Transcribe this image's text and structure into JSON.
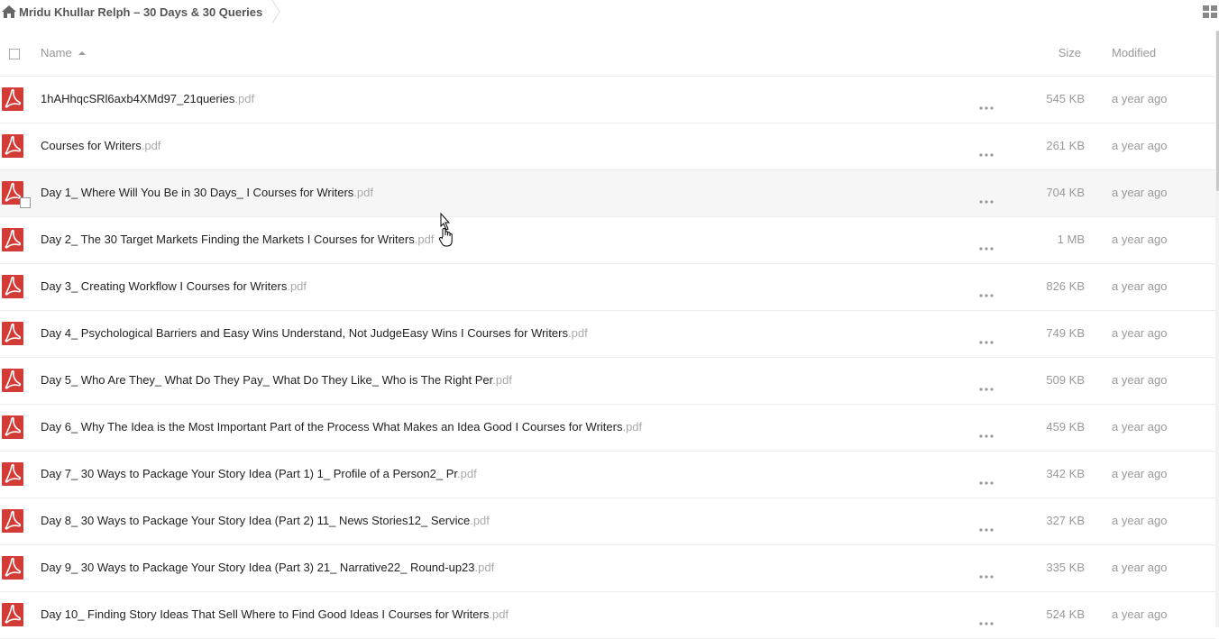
{
  "breadcrumb": {
    "label": "Mridu Khullar Relph – 30 Days & 30 Queries"
  },
  "header": {
    "name": "Name",
    "size": "Size",
    "modified": "Modified"
  },
  "colors": {
    "pdf_red": "#d23b36",
    "muted_text": "#999999",
    "extension": "#aaaaaa"
  },
  "files": [
    {
      "name": "1hAHhqcSRl6axb4XMd97_21queries",
      "ext": ".pdf",
      "size": "545 KB",
      "modified": "a year ago"
    },
    {
      "name": "Courses for Writers",
      "ext": ".pdf",
      "size": "261 KB",
      "modified": "a year ago"
    },
    {
      "name": "Day 1_ Where Will You Be in 30 Days_ I Courses for Writers",
      "ext": ".pdf",
      "size": "704 KB",
      "modified": "a year ago"
    },
    {
      "name": "Day 2_ The 30 Target Markets Finding the Markets I Courses for Writers",
      "ext": ".pdf",
      "size": "1 MB",
      "modified": "a year ago"
    },
    {
      "name": "Day 3_ Creating Workflow I Courses for Writers",
      "ext": ".pdf",
      "size": "826 KB",
      "modified": "a year ago"
    },
    {
      "name": "Day 4_ Psychological Barriers and Easy Wins Understand, Not JudgeEasy Wins I Courses for Writers",
      "ext": ".pdf",
      "size": "749 KB",
      "modified": "a year ago"
    },
    {
      "name": "Day 5_ Who Are They_ What Do They Pay_ What Do They Like_ Who is The Right Per",
      "ext": ".pdf",
      "size": "509 KB",
      "modified": "a year ago"
    },
    {
      "name": "Day 6_ Why The Idea is the Most Important Part of the Process What Makes an Idea Good I Courses for Writers",
      "ext": ".pdf",
      "size": "459 KB",
      "modified": "a year ago"
    },
    {
      "name": "Day 7_ 30 Ways to Package Your Story Idea (Part 1) 1_ Profile of a Person2_ Pr",
      "ext": ".pdf",
      "size": "342 KB",
      "modified": "a year ago"
    },
    {
      "name": "Day 8_ 30 Ways to Package Your Story Idea (Part 2) 11_ News Stories12_ Service",
      "ext": ".pdf",
      "size": "327 KB",
      "modified": "a year ago"
    },
    {
      "name": "Day 9_ 30 Ways to Package Your Story Idea (Part 3) 21_ Narrative22_ Round-up23",
      "ext": ".pdf",
      "size": "335 KB",
      "modified": "a year ago"
    },
    {
      "name": "Day 10_ Finding Story Ideas That Sell Where to Find Good Ideas I Courses for Writers",
      "ext": ".pdf",
      "size": "524 KB",
      "modified": "a year ago"
    }
  ]
}
